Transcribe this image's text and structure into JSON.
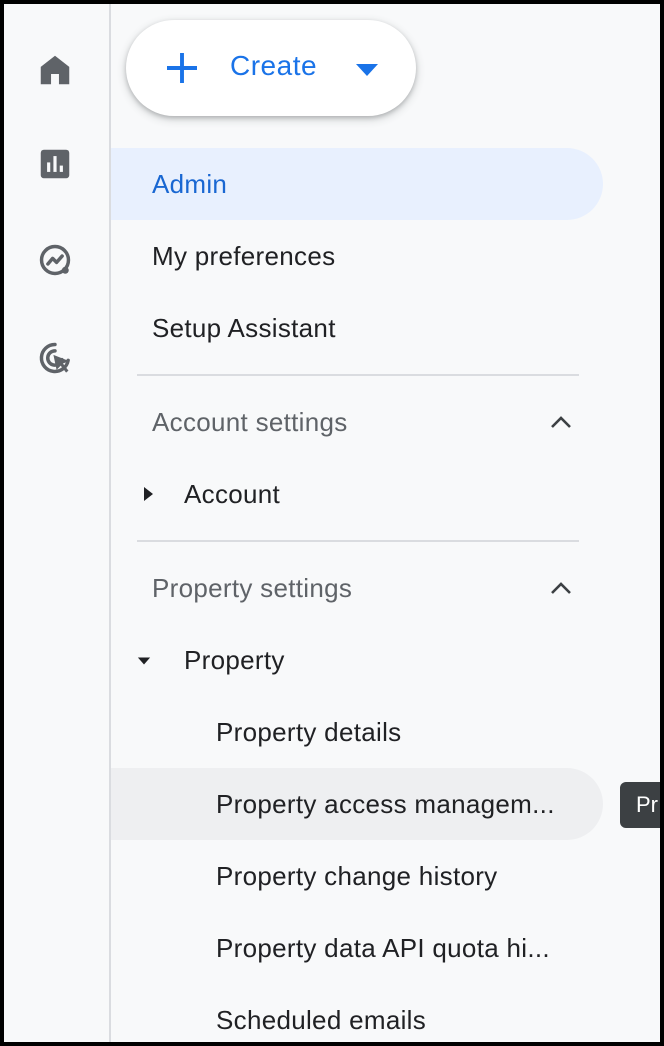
{
  "rail": {
    "icons": [
      "home-icon",
      "reports-icon",
      "explore-icon",
      "advertising-icon"
    ]
  },
  "create_button": {
    "label": "Create"
  },
  "nav": {
    "items": [
      {
        "label": "Admin",
        "active": true
      },
      {
        "label": "My preferences",
        "active": false
      },
      {
        "label": "Setup Assistant",
        "active": false
      }
    ]
  },
  "account_settings": {
    "title": "Account settings",
    "expanded": true,
    "children": [
      {
        "label": "Account",
        "expanded": false
      }
    ]
  },
  "property_settings": {
    "title": "Property settings",
    "expanded": true,
    "children": [
      {
        "label": "Property",
        "expanded": true,
        "children": [
          {
            "label": "Property details"
          },
          {
            "label": "Property access managem..."
          },
          {
            "label": "Property change history"
          },
          {
            "label": "Property data API quota hi..."
          },
          {
            "label": "Scheduled emails"
          }
        ]
      }
    ]
  },
  "tooltip": {
    "text": "Pr"
  },
  "colors": {
    "accent": "#1a73e8",
    "active_bg": "#e8f0fe",
    "rail_icon": "#5f6368"
  }
}
